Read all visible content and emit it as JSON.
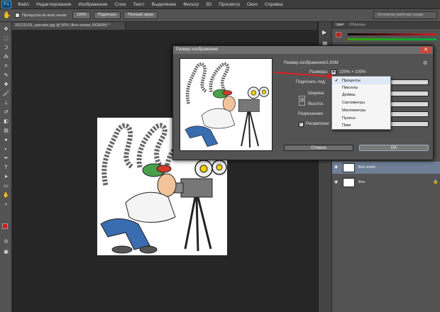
{
  "app": {
    "logo": "Ps"
  },
  "menu": [
    "Файл",
    "Редактирование",
    "Изображение",
    "Слои",
    "Текст",
    "Выделение",
    "Фильтр",
    "3D",
    "Просмотр",
    "Окно",
    "Справка"
  ],
  "options_bar": {
    "scroll_all": "Прокрутка во всех окнах",
    "btn_100": "100%",
    "btn_fit": "Подогнать",
    "btn_full": "Полный экран",
    "workspace": "Основная рабочая среда"
  },
  "document_tab": "20121015_operator.jpg @ 50% (Фон копия, RGB/8#) *",
  "dialog": {
    "title": "Размер изображения",
    "image_size_label": "Размер изображения:",
    "image_size_value": "1,63M",
    "dimensions_label": "Размеры:",
    "dimensions_value": "100% × 100%",
    "fit_to_label": "Подогнать под:",
    "width_label": "Ширина:",
    "height_label": "Высота:",
    "resolution_label": "Разрешение:",
    "resample_label": "Ресамплинг",
    "resample_checked": true,
    "cancel": "Отмена",
    "ok": "OK"
  },
  "dropdown": {
    "selected_index": 0,
    "options": [
      "Проценты",
      "Пикселы",
      "Дюймы",
      "Сантиметры",
      "Миллиметры",
      "Пункты",
      "Пики"
    ]
  },
  "panels": {
    "tabs": [
      "Цвет",
      "Образцы"
    ],
    "layers": [
      {
        "name": "Фон копия",
        "selected": true
      },
      {
        "name": "Фон",
        "selected": false
      }
    ]
  },
  "colors": {
    "accent_arrow": "#d92020",
    "selected_layer": "#6f7f97",
    "foreground": "#c81e1e",
    "background": "#1a1a1a"
  }
}
